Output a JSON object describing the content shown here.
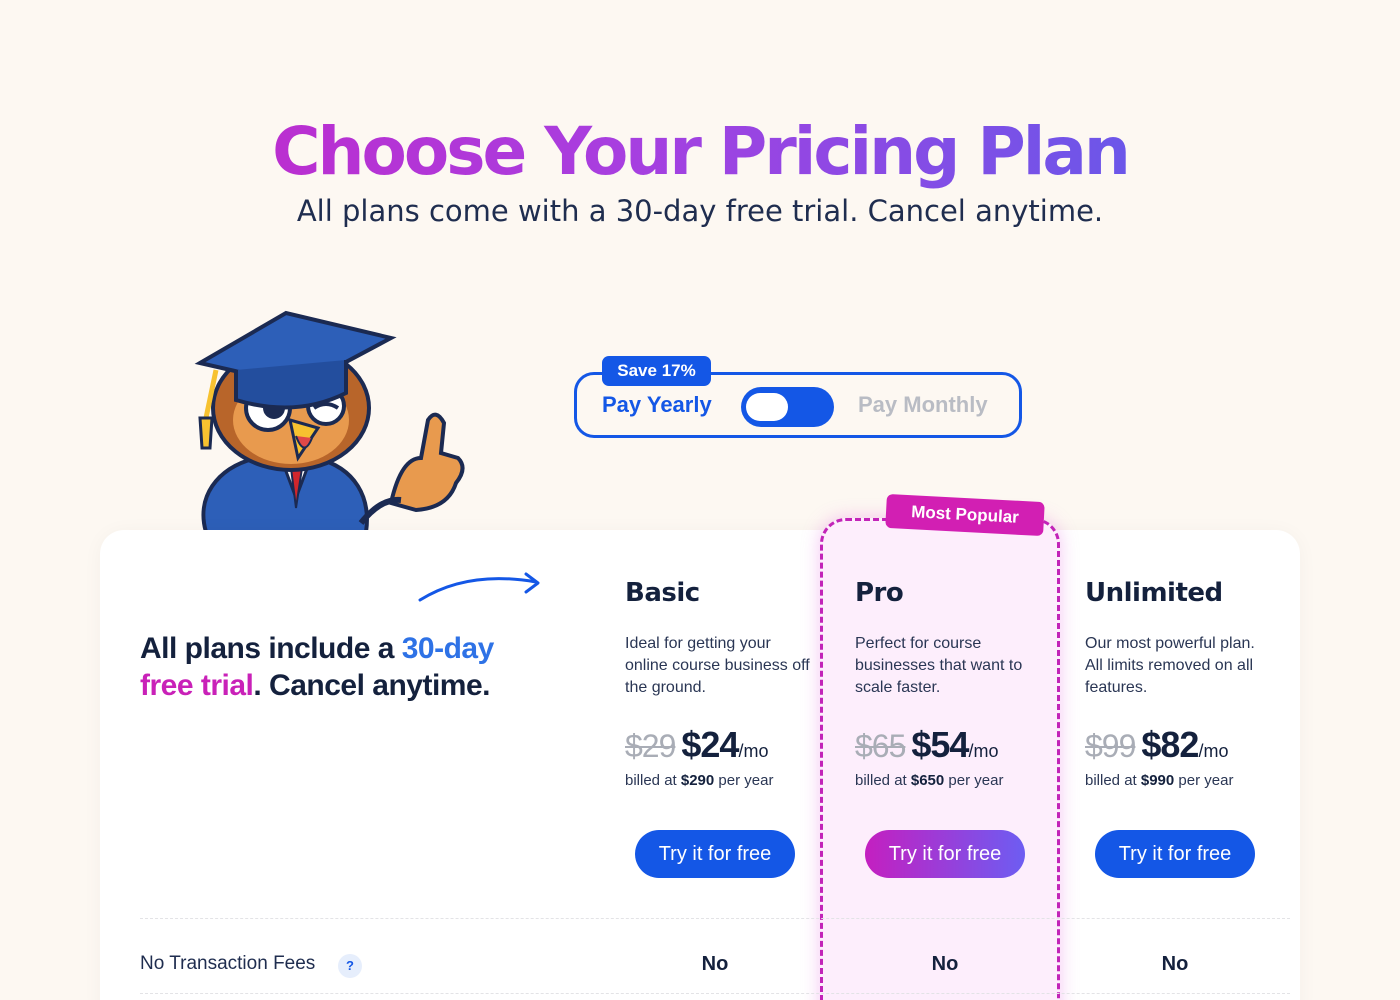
{
  "hero": {
    "title": "Choose Your Pricing Plan",
    "subtitle": "All plans come with a 30-day free trial. Cancel anytime."
  },
  "toggle": {
    "badge": "Save 17%",
    "yearly_label": "Pay Yearly",
    "monthly_label": "Pay Monthly",
    "selected": "yearly"
  },
  "intro": {
    "part1": "All plans include a ",
    "highlight_blue": "30-day",
    "highlight_pink": "free trial",
    "part2": ". Cancel anytime."
  },
  "popular_badge": "Most Popular",
  "plans": [
    {
      "name": "Basic",
      "description": "Ideal for getting your online course business off the ground.",
      "old_price": "$29",
      "price": "$24",
      "unit": "/mo",
      "billed_prefix": "billed at ",
      "billed_amount": "$290",
      "billed_suffix": " per year",
      "cta": "Try it for free"
    },
    {
      "name": "Pro",
      "description": "Perfect for course businesses that want to scale faster.",
      "old_price": "$65",
      "price": "$54",
      "unit": "/mo",
      "billed_prefix": "billed at ",
      "billed_amount": "$650",
      "billed_suffix": " per year",
      "cta": "Try it for free"
    },
    {
      "name": "Unlimited",
      "description": "Our most powerful plan. All limits removed on all features.",
      "old_price": "$99",
      "price": "$82",
      "unit": "/mo",
      "billed_prefix": "billed at ",
      "billed_amount": "$990",
      "billed_suffix": " per year",
      "cta": "Try it for free"
    }
  ],
  "features": [
    {
      "label": "No Transaction Fees",
      "help": "?",
      "values": [
        "No",
        "No",
        "No"
      ]
    }
  ],
  "colors": {
    "brand_blue": "#1457e6",
    "brand_pink": "#d21fb3",
    "page_bg": "#fdf8f2"
  }
}
